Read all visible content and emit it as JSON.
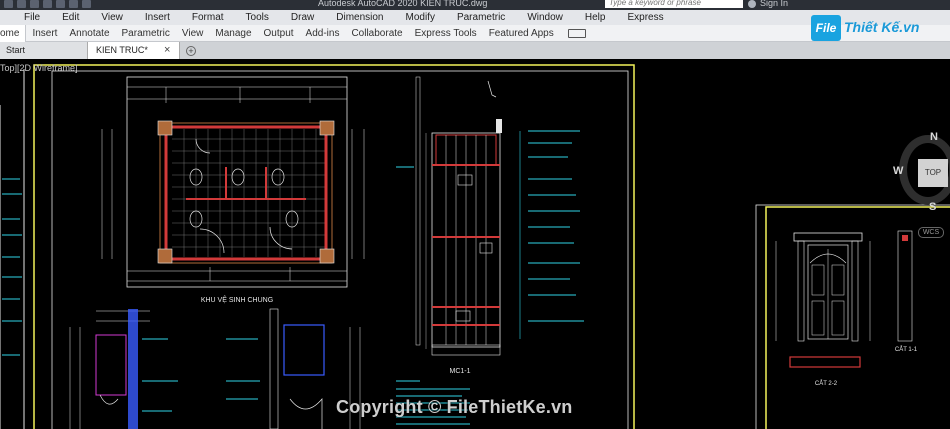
{
  "titlebar": {
    "app_title": "Autodesk AutoCAD 2020   KIEN TRUC.dwg",
    "search_placeholder": "Type a keyword or phrase",
    "sign_in": "Sign In"
  },
  "menubar": {
    "items": [
      "File",
      "Edit",
      "View",
      "Insert",
      "Format",
      "Tools",
      "Draw",
      "Dimension",
      "Modify",
      "Parametric",
      "Window",
      "Help",
      "Express"
    ]
  },
  "ribbon": {
    "tabs": [
      "ome",
      "Insert",
      "Annotate",
      "Parametric",
      "View",
      "Manage",
      "Output",
      "Add-ins",
      "Collaborate",
      "Express Tools",
      "Featured Apps"
    ]
  },
  "doctabs": {
    "start": "Start",
    "document": "KIEN TRUC*",
    "close_glyph": "×",
    "plus_glyph": "+"
  },
  "viewport": {
    "label": "Top][2D Wireframe]"
  },
  "viewcube": {
    "north": "N",
    "south": "S",
    "west": "W",
    "face": "TOP",
    "wcs": "WCS"
  },
  "logo": {
    "mark": "File",
    "text": "Thiết Kế.vn"
  },
  "drawing_labels": {
    "plan_title": "KHU VỆ SINH CHUNG",
    "section_title": "MC1-1",
    "door_section": "CẮT 2-2",
    "door_section_b": "CẮT 1-1"
  },
  "watermark": "Copyright © FileThietKe.vn",
  "colors": {
    "frame_yellow": "#f2f25a",
    "cad_white": "#e6e6e6",
    "cad_cyan": "#2fd3e6",
    "cad_red": "#d23a3a",
    "cad_magenta": "#d23ad2",
    "cad_blue": "#3a5cff",
    "cad_green": "#39d339"
  }
}
